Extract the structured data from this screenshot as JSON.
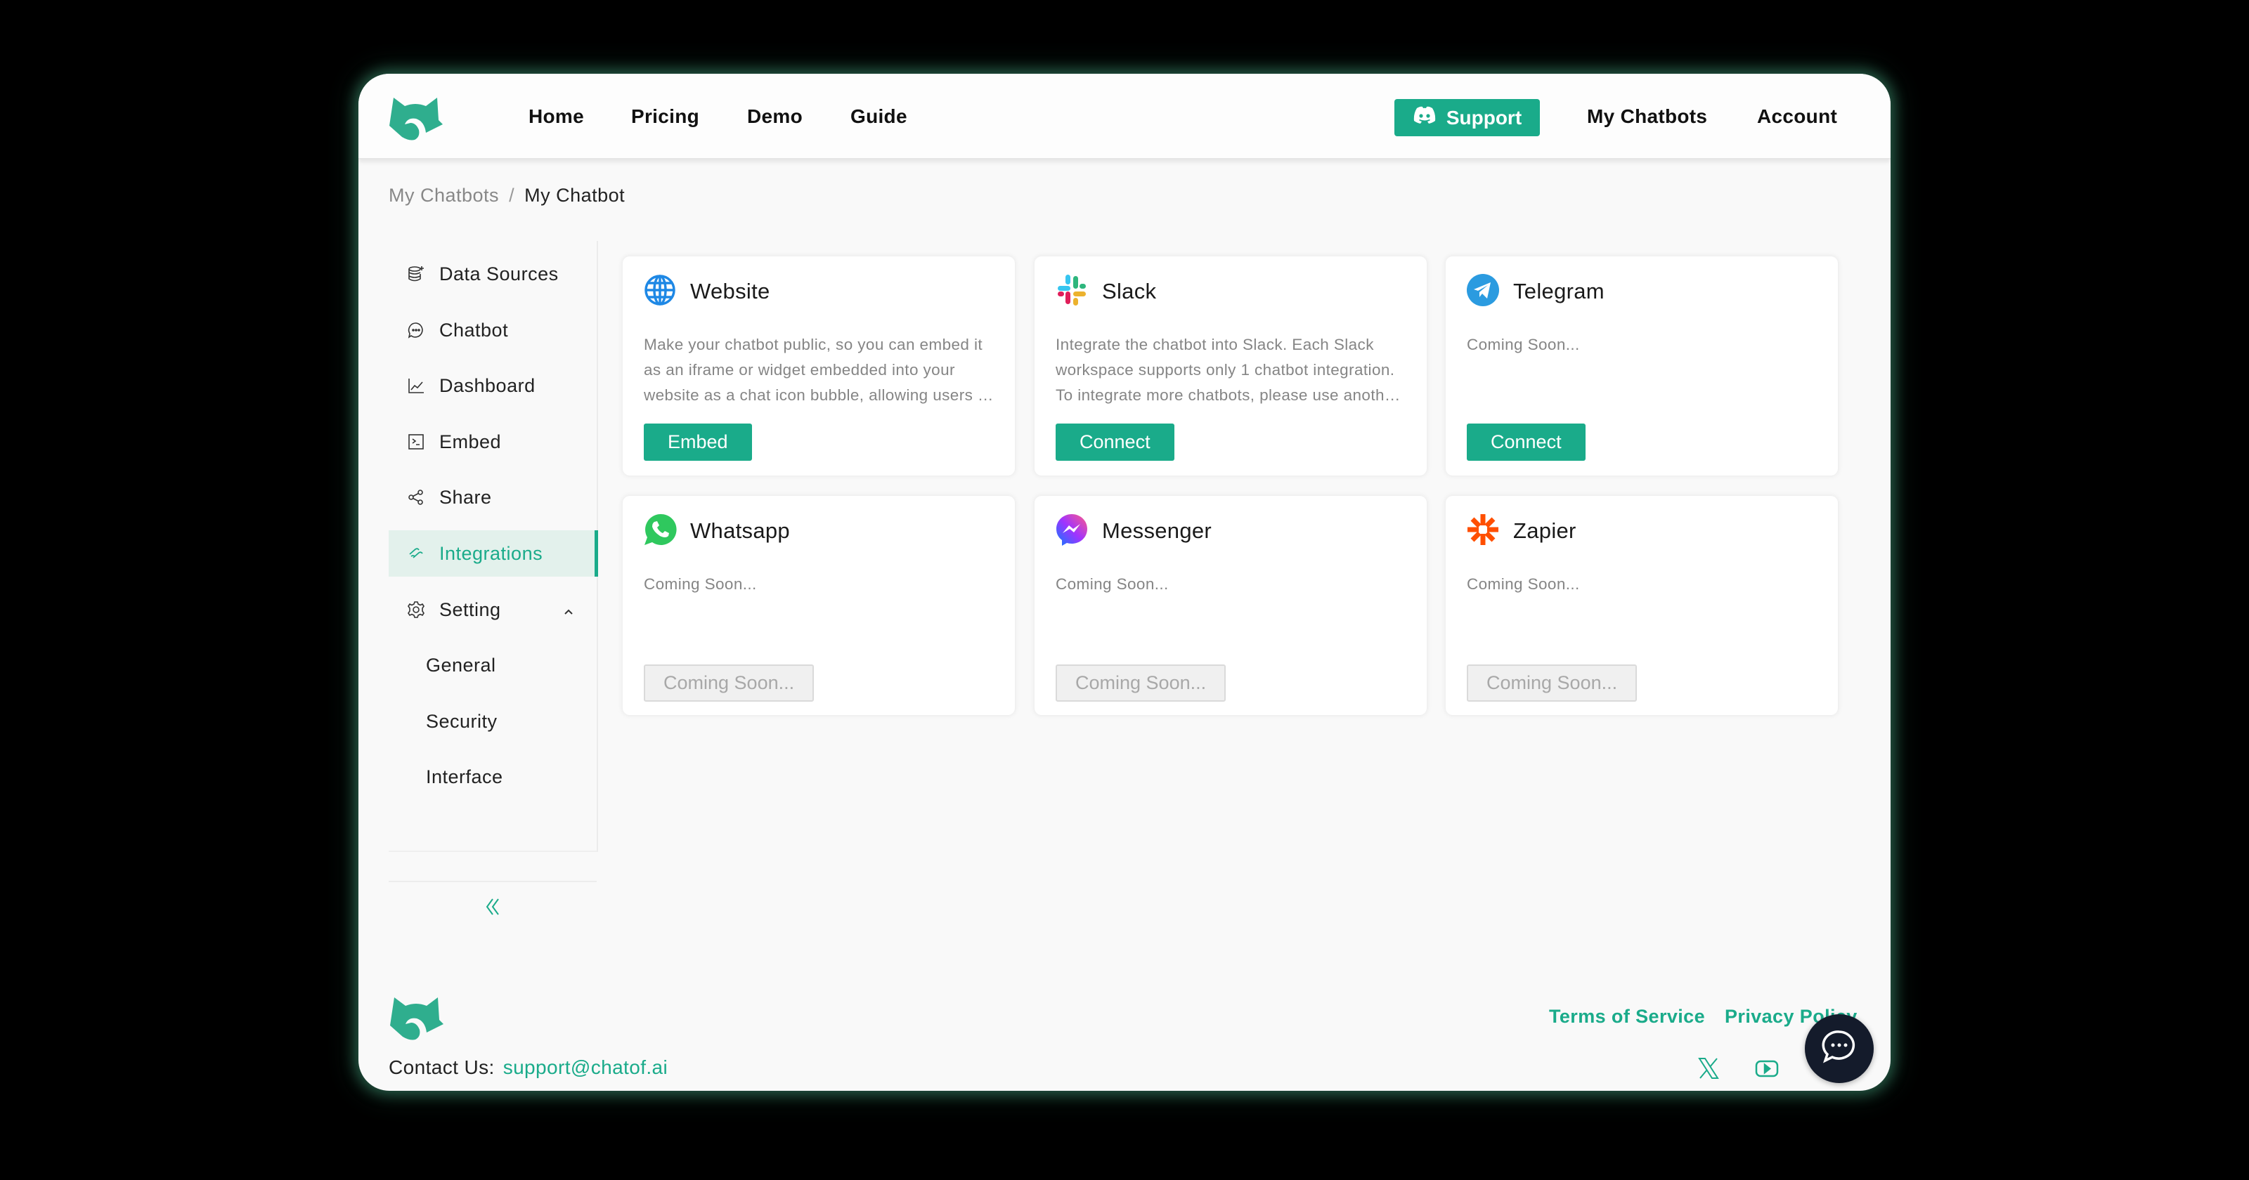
{
  "header": {
    "nav": [
      "Home",
      "Pricing",
      "Demo",
      "Guide"
    ],
    "support_label": "Support",
    "my_chatbots_label": "My Chatbots",
    "account_label": "Account"
  },
  "breadcrumb": {
    "parent": "My Chatbots",
    "separator": "/",
    "current": "My Chatbot"
  },
  "sidebar": {
    "items": [
      {
        "label": "Data Sources",
        "icon": "database-icon"
      },
      {
        "label": "Chatbot",
        "icon": "chat-icon"
      },
      {
        "label": "Dashboard",
        "icon": "line-chart-icon"
      },
      {
        "label": "Embed",
        "icon": "terminal-icon"
      },
      {
        "label": "Share",
        "icon": "share-icon"
      },
      {
        "label": "Integrations",
        "icon": "link-icon",
        "active": true
      },
      {
        "label": "Setting",
        "icon": "gear-icon",
        "expanded": true
      }
    ],
    "sub_items": [
      "General",
      "Security",
      "Interface"
    ],
    "collapse_icon": "double-chevron-left-icon"
  },
  "integrations": [
    {
      "name": "Website",
      "icon": "globe-icon",
      "description": "Make your chatbot public, so you can embed it as an iframe or widget embedded into your website as a chat icon bubble, allowing users to chat with your chatbot.",
      "button": "Embed",
      "enabled": true
    },
    {
      "name": "Slack",
      "icon": "slack-icon",
      "description": "Integrate the chatbot into Slack. Each Slack workspace supports only 1 chatbot integration. To integrate more chatbots, please use another workspace.",
      "button": "Connect",
      "enabled": true
    },
    {
      "name": "Telegram",
      "icon": "telegram-icon",
      "description": "Coming Soon...",
      "button": "Connect",
      "enabled": true
    },
    {
      "name": "Whatsapp",
      "icon": "whatsapp-icon",
      "description": "Coming Soon...",
      "button": "Coming Soon...",
      "enabled": false
    },
    {
      "name": "Messenger",
      "icon": "messenger-icon",
      "description": "Coming Soon...",
      "button": "Coming Soon...",
      "enabled": false
    },
    {
      "name": "Zapier",
      "icon": "zapier-icon",
      "description": "Coming Soon...",
      "button": "Coming Soon...",
      "enabled": false
    }
  ],
  "footer": {
    "contact_label": "Contact Us:",
    "contact_email": "support@chatof.ai",
    "links": [
      "Terms of Service",
      "Privacy Policy"
    ],
    "social": [
      "x-icon",
      "youtube-icon"
    ]
  },
  "colors": {
    "accent": "#1aab8a",
    "active_bg": "#e3f1ec",
    "chat_bubble": "#141b2b"
  }
}
